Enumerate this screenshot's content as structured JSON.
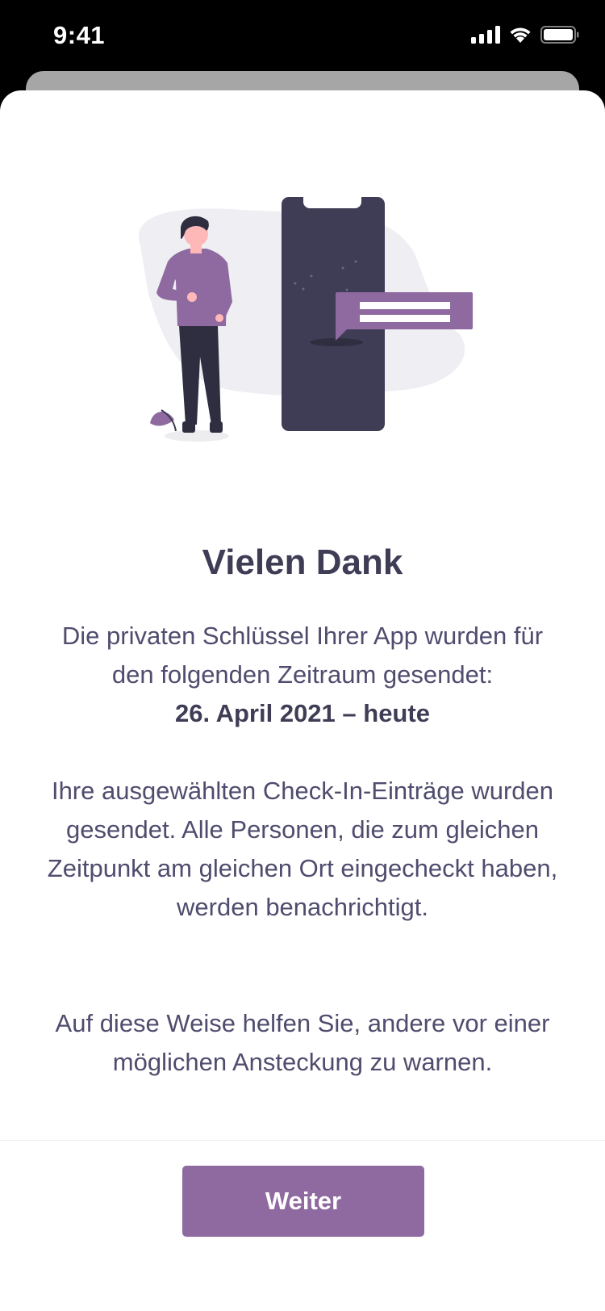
{
  "status_bar": {
    "time": "9:41"
  },
  "thanks_screen": {
    "title": "Vielen Dank",
    "keys_sent_text": "Die privaten Schlüssel Ihrer App wurden für den folgenden Zeitraum gesendet:",
    "date_range": "26. April 2021 – heute",
    "checkins_text": "Ihre ausgewählten Check-In-Einträge wurden gesendet. Alle Personen, die zum gleichen Zeitpunkt am gleichen Ort eingecheckt haben, werden benachrichtigt.",
    "warning_text": "Auf diese Weise helfen Sie, andere vor einer möglichen Ansteckung zu warnen.",
    "next_button": "Weiter"
  },
  "colors": {
    "accent": "#8e6aa0",
    "title": "#3f3d56",
    "text": "#4f4c6e",
    "phone_dark": "#3f3d56"
  },
  "icons": [
    "cellular-signal-icon",
    "wifi-icon",
    "battery-icon"
  ]
}
